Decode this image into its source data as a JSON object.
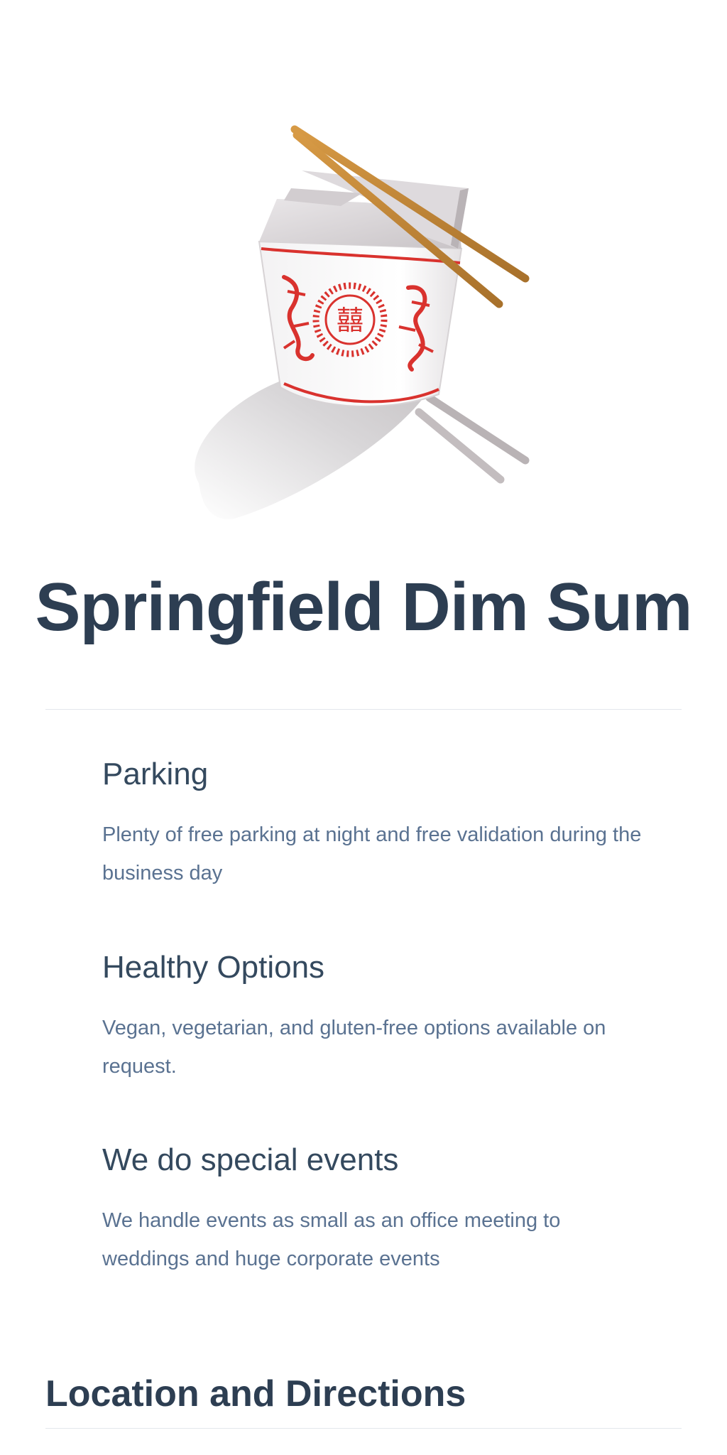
{
  "hero": {
    "image_icon": "takeout-box-with-chopsticks-icon",
    "title": "Springfield Dim Sum"
  },
  "features": [
    {
      "heading": "Parking",
      "text": "Plenty of free parking at night and free validation during the business day"
    },
    {
      "heading": "Healthy Options",
      "text": "Vegan, vegetarian, and gluten-free options available on request."
    },
    {
      "heading": "We do special events",
      "text": "We handle events as small as an office meeting to weddings and huge corporate events"
    }
  ],
  "location": {
    "heading": "Location and Directions"
  },
  "colors": {
    "title": "#2d3e52",
    "body_text": "#5a7291",
    "box_red": "#d9322e",
    "chopstick": "#c58a3a"
  }
}
